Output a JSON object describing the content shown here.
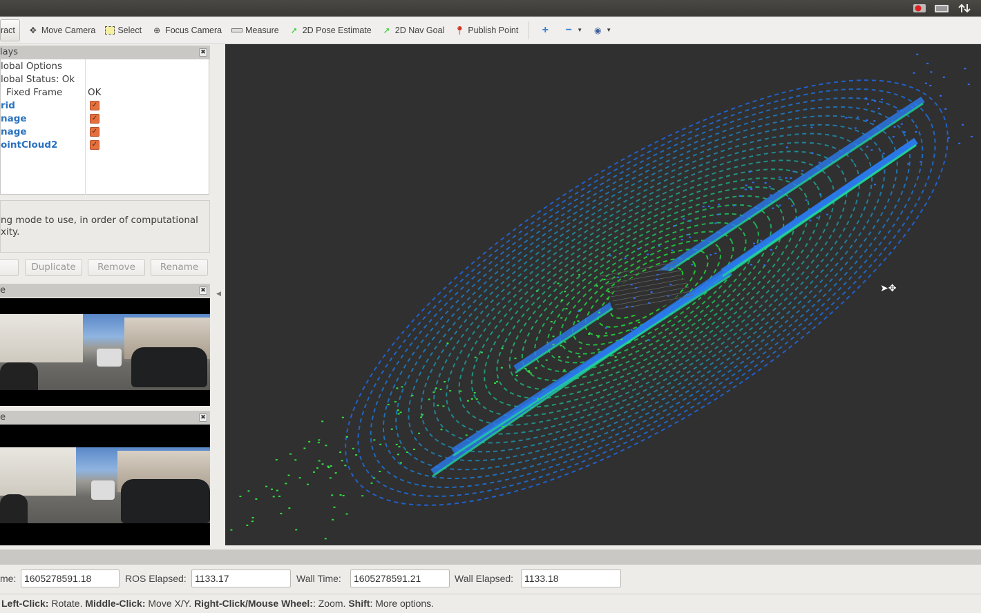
{
  "system_tray": {
    "icons": [
      "record-icon",
      "keyboard-icon",
      "network-arrows-icon"
    ]
  },
  "toolbar": {
    "items": [
      {
        "label": "ract",
        "icon": "interact-icon"
      },
      {
        "label": "Move Camera",
        "icon": "move-camera-icon"
      },
      {
        "label": "Select",
        "icon": "select-icon"
      },
      {
        "label": "Focus Camera",
        "icon": "focus-camera-icon"
      },
      {
        "label": "Measure",
        "icon": "ruler-icon"
      },
      {
        "label": "2D Pose Estimate",
        "icon": "green-arrow-icon"
      },
      {
        "label": "2D Nav Goal",
        "icon": "green-arrow-icon"
      },
      {
        "label": "Publish Point",
        "icon": "map-pin-icon"
      }
    ],
    "extra": [
      "plus-icon",
      "minus-icon",
      "eye-icon"
    ]
  },
  "displays": {
    "title": "lays",
    "tree": [
      {
        "label": "lobal Options",
        "value": ""
      },
      {
        "label": "lobal Status: Ok",
        "value": ""
      },
      {
        "label": "Fixed Frame",
        "value": "OK"
      },
      {
        "label": "rid",
        "checked": true
      },
      {
        "label": "nage",
        "checked": true
      },
      {
        "label": "nage",
        "checked": true
      },
      {
        "label": "ointCloud2",
        "checked": true
      }
    ],
    "description": "ng mode to use, in order of computational\nxity.",
    "buttons": [
      "",
      "Duplicate",
      "Remove",
      "Rename"
    ]
  },
  "image_panels": [
    {
      "title": "e"
    },
    {
      "title": "e"
    }
  ],
  "time": {
    "header": "",
    "ros_time_label": "me:",
    "ros_time": "1605278591.18",
    "ros_elapsed_label": "ROS Elapsed:",
    "ros_elapsed": "1133.17",
    "wall_time_label": "Wall Time:",
    "wall_time": "1605278591.21",
    "wall_elapsed_label": "Wall Elapsed:",
    "wall_elapsed": "1133.18"
  },
  "status": {
    "parts": [
      {
        "b": "Left-Click:",
        "t": " Rotate. "
      },
      {
        "b": "Middle-Click:",
        "t": " Move X/Y. "
      },
      {
        "b": "Right-Click/Mouse Wheel:",
        "t": ": Zoom. "
      },
      {
        "b": "Shift",
        "t": ": More options."
      }
    ]
  },
  "colors": {
    "viewport_bg": "#303030",
    "checkbox": "#e4703e",
    "display_name": "#2a72c0",
    "cloud_near": "#22ee22",
    "cloud_far": "#2255ee"
  }
}
